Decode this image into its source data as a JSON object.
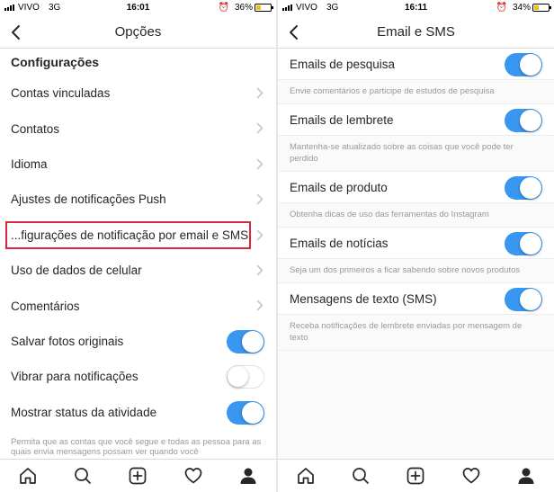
{
  "left": {
    "status": {
      "carrier": "VIVO",
      "network": "3G",
      "time": "16:01",
      "battery": "36%",
      "battery_level": 0.36
    },
    "nav": {
      "title": "Opções"
    },
    "header": "Configurações",
    "rows": [
      {
        "label": "Contas vinculadas",
        "type": "chevron"
      },
      {
        "label": "Contatos",
        "type": "chevron"
      },
      {
        "label": "Idioma",
        "type": "chevron"
      },
      {
        "label": "Ajustes de notificações Push",
        "type": "chevron"
      },
      {
        "label": "...figurações de notificação por email e SMS",
        "type": "chevron",
        "highlight": true
      },
      {
        "label": "Uso de dados de celular",
        "type": "chevron"
      },
      {
        "label": "Comentários",
        "type": "chevron"
      },
      {
        "label": "Salvar fotos originais",
        "type": "toggle",
        "on": true
      },
      {
        "label": "Vibrar para notificações",
        "type": "toggle",
        "on": false
      },
      {
        "label": "Mostrar status da atividade",
        "type": "toggle",
        "on": true
      }
    ],
    "footnote": "Permita que as contas que você segue e todas as pessoa para as quais envia mensagens possam ver quando você"
  },
  "right": {
    "status": {
      "carrier": "VIVO",
      "network": "3G",
      "time": "16:11",
      "battery": "34%",
      "battery_level": 0.34
    },
    "nav": {
      "title": "Email e SMS"
    },
    "items": [
      {
        "label": "Emails de pesquisa",
        "on": true,
        "desc": "Envie comentários e participe de estudos de pesquisa"
      },
      {
        "label": "Emails de lembrete",
        "on": true,
        "desc": "Mantenha-se atualizado sobre as coisas que você pode ter perdido"
      },
      {
        "label": "Emails de produto",
        "on": true,
        "desc": "Obtenha dicas de uso das ferramentas do Instagram"
      },
      {
        "label": "Emails de notícias",
        "on": true,
        "desc": "Seja um dos primeiros a ficar sabendo sobre novos produtos"
      },
      {
        "label": "Mensagens de texto (SMS)",
        "on": true,
        "desc": "Receba notificações de lembrete enviadas por mensagem de texto"
      }
    ]
  },
  "colors": {
    "accent": "#3897f0",
    "highlight": "#d3293b",
    "text": "#262626",
    "muted": "#999999"
  },
  "tab_icons": [
    "home-icon",
    "search-icon",
    "add-post-icon",
    "heart-icon",
    "profile-icon"
  ]
}
